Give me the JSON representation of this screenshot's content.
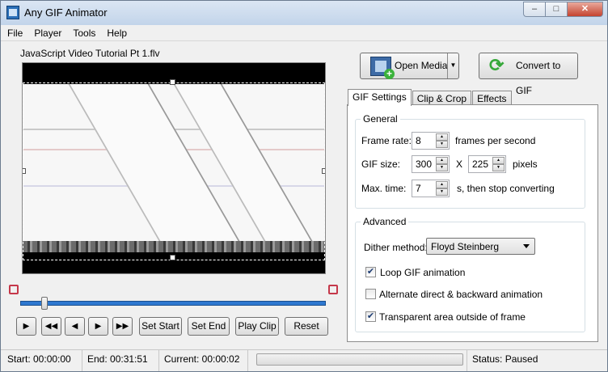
{
  "window": {
    "title": "Any GIF Animator"
  },
  "menu": [
    "File",
    "Player",
    "Tools",
    "Help"
  ],
  "player": {
    "file_name": "JavaScript Video Tutorial Pt 1.flv",
    "slider_position": 0.07,
    "controls": {
      "set_start": "Set Start",
      "set_end": "Set End",
      "play_clip": "Play Clip",
      "reset": "Reset"
    }
  },
  "toolbar": {
    "open_media": "Open Media",
    "convert": "Convert to GIF"
  },
  "tabs": [
    "GIF Settings",
    "Clip & Crop",
    "Effects"
  ],
  "general": {
    "title": "General",
    "frame_rate_label": "Frame rate:",
    "frame_rate_value": "8",
    "frame_rate_unit": "frames per second",
    "gif_size_label": "GIF size:",
    "width": "300",
    "x_label": "X",
    "height": "225",
    "size_unit": "pixels",
    "max_time_label": "Max. time:",
    "max_time_value": "7",
    "max_time_unit": "s, then stop converting"
  },
  "advanced": {
    "title": "Advanced",
    "dither_label": "Dither method:",
    "dither_value": "Floyd Steinberg",
    "loop_label": "Loop GIF animation",
    "loop_checked": true,
    "alternate_label": "Alternate direct & backward animation",
    "alternate_checked": false,
    "transparent_label": "Transparent area outside of frame",
    "transparent_checked": true
  },
  "status": {
    "start": "Start: 00:00:00",
    "end": "End: 00:31:51",
    "current": "Current: 00:00:02",
    "progress": 0,
    "state": "Status: Paused"
  }
}
